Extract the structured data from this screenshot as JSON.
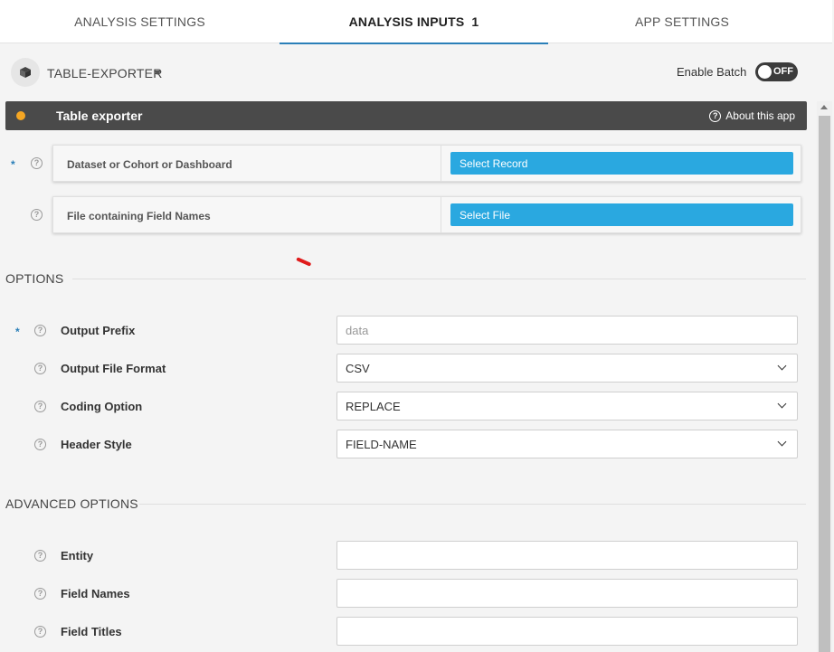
{
  "tabs": [
    {
      "label": "ANALYSIS SETTINGS"
    },
    {
      "label": "ANALYSIS INPUTS",
      "badge": "1"
    },
    {
      "label": "APP SETTINGS"
    }
  ],
  "app": {
    "name": "TABLE-EXPORTER",
    "batch_label": "Enable Batch",
    "batch_toggle": "OFF"
  },
  "panel": {
    "title": "Table exporter",
    "about_label": "About this app"
  },
  "inputs": [
    {
      "label": "Dataset or Cohort or Dashboard",
      "button": "Select Record",
      "required": "*"
    },
    {
      "label": "File containing Field Names",
      "button": "Select File"
    }
  ],
  "options": {
    "heading": "OPTIONS",
    "rows": [
      {
        "label": "Output Prefix",
        "placeholder": "data",
        "required": "*"
      },
      {
        "label": "Output File Format",
        "value": "CSV"
      },
      {
        "label": "Coding Option",
        "value": "REPLACE"
      },
      {
        "label": "Header Style",
        "value": "FIELD-NAME"
      }
    ]
  },
  "advanced": {
    "heading": "ADVANCED OPTIONS",
    "rows": [
      {
        "label": "Entity",
        "value": ""
      },
      {
        "label": "Field Names",
        "value": ""
      },
      {
        "label": "Field Titles",
        "value": ""
      }
    ]
  },
  "colors": {
    "accent": "#2a7fb8",
    "button": "#2aa8e0",
    "titlebar": "#4a4a4a",
    "status_dot": "#f5a623",
    "mark": "#e01b1b"
  }
}
